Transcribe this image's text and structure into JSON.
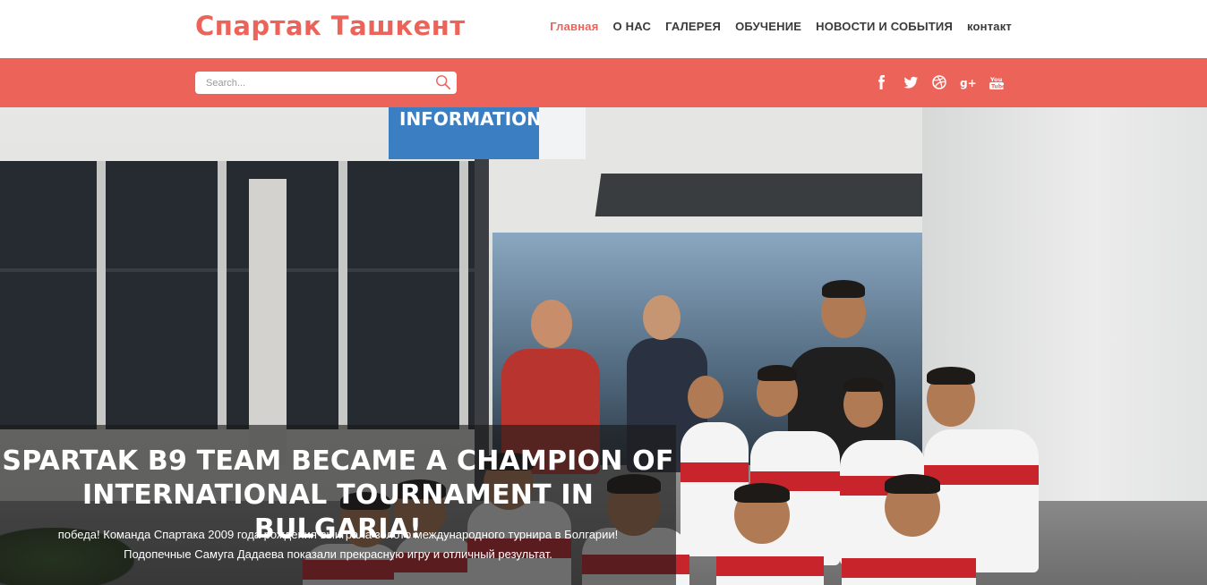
{
  "header": {
    "logo": "Спартак Ташкент",
    "nav": [
      {
        "label": "Главная",
        "active": true
      },
      {
        "label": "О НАС",
        "active": false
      },
      {
        "label": "ГАЛЕРЕЯ",
        "active": false
      },
      {
        "label": "ОБУЧЕНИЕ",
        "active": false
      },
      {
        "label": "НОВОСТИ И СОБЫТИЯ",
        "active": false
      },
      {
        "label": "контакт",
        "active": false
      }
    ]
  },
  "toolbar": {
    "search_placeholder": "Search...",
    "social_icons": [
      "facebook-icon",
      "twitter-icon",
      "dribbble-icon",
      "google-plus-icon",
      "youtube-icon"
    ]
  },
  "hero": {
    "sign_text": "INFORMATION",
    "title_line1": "SPARTAK B9 TEAM BECAME A CHAMPION OF",
    "title_line2": "INTERNATIONAL TOURNAMENT IN BULGARIA!",
    "text_line1": "победа! Команда Спартака 2009 года рождения выиграла золото международного турнира в Болгарии!",
    "text_line2": "Подопечные Самуга Дадаева показали прекрасную игру и отличный результат."
  },
  "colors": {
    "accent": "#ec6359",
    "nav_text": "#3a3a3a",
    "caption_bg": "rgba(25,25,25,0.62)"
  }
}
